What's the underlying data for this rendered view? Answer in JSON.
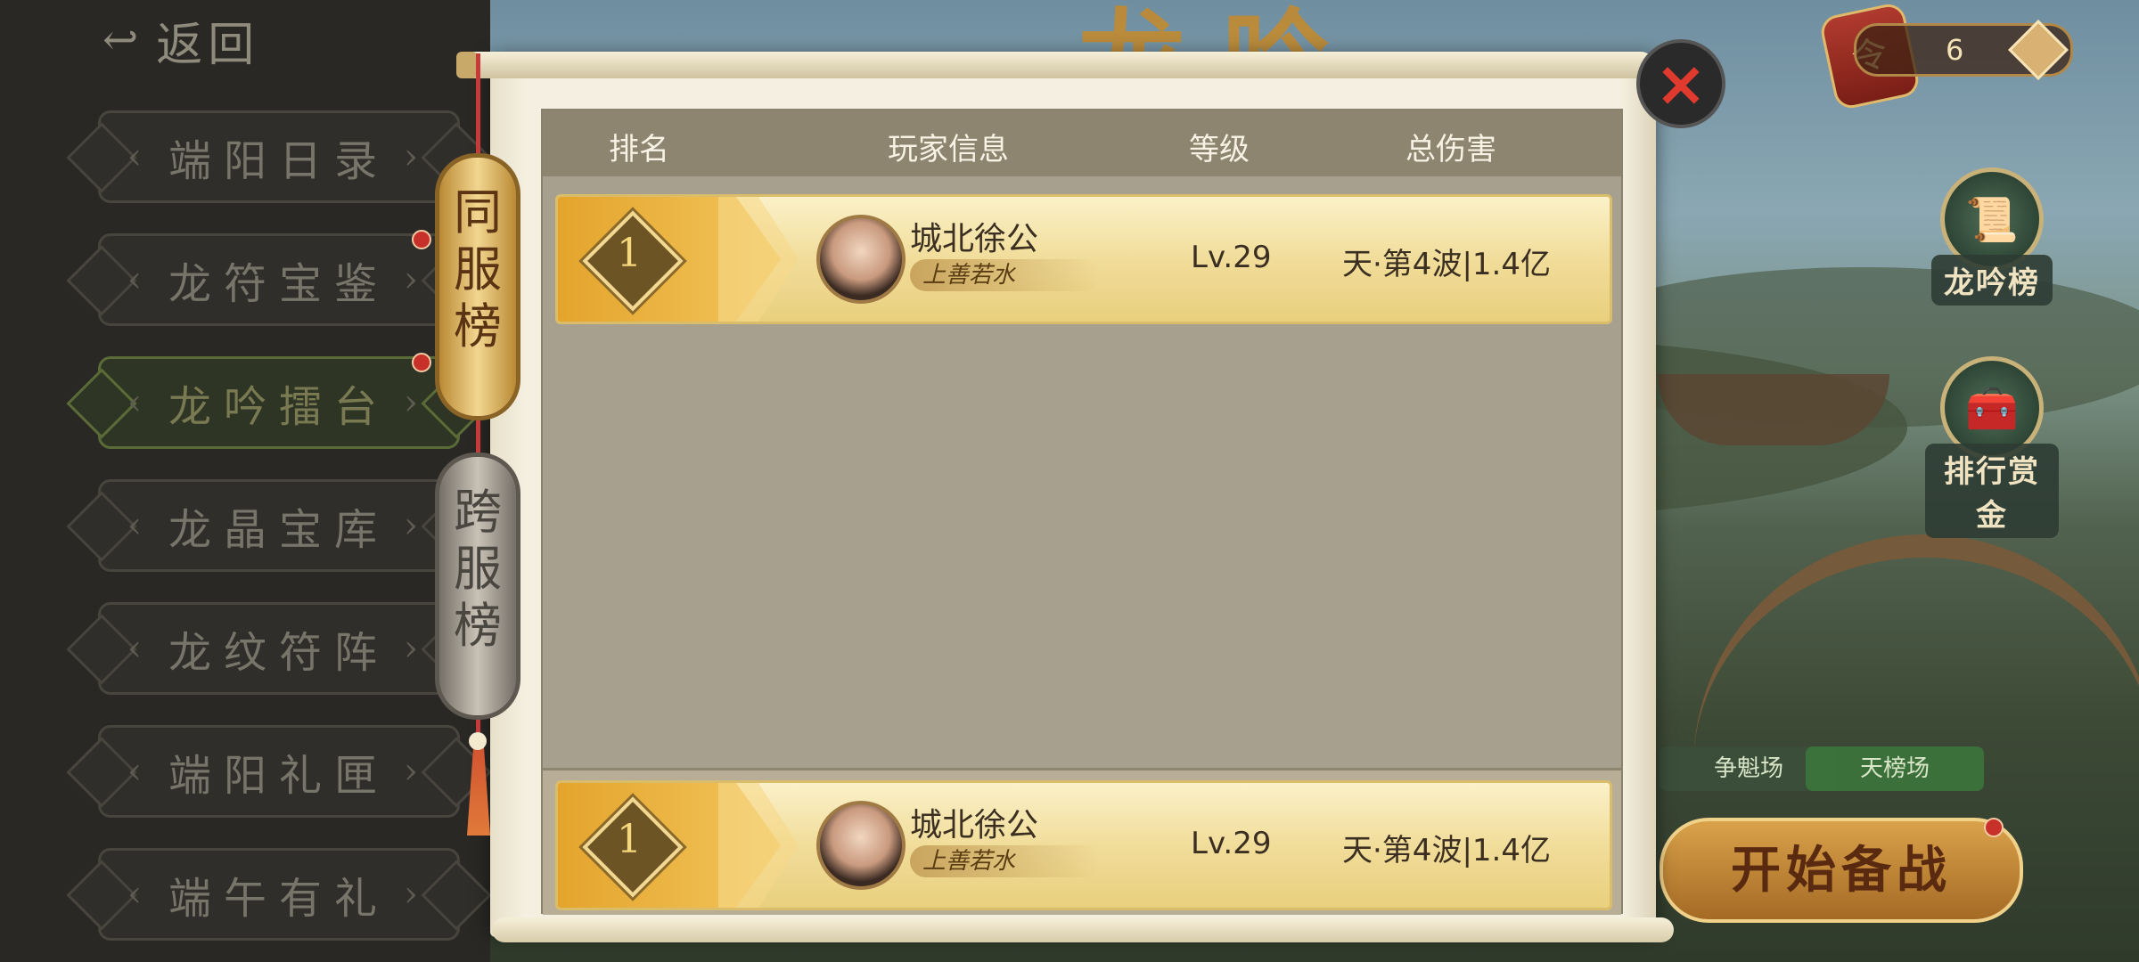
{
  "back_label": "返回",
  "menu": [
    {
      "label": "端阳日录",
      "active": false
    },
    {
      "label": "龙符宝鉴",
      "active": false
    },
    {
      "label": "龙吟擂台",
      "active": true
    },
    {
      "label": "龙晶宝库",
      "active": false
    },
    {
      "label": "龙纹符阵",
      "active": false
    },
    {
      "label": "端阳礼匣",
      "active": false
    },
    {
      "label": "端午有礼",
      "active": false
    }
  ],
  "tabs": {
    "same_server": "同服榜",
    "cross_server": "跨服榜"
  },
  "table": {
    "headers": {
      "rank": "排名",
      "player": "玩家信息",
      "level": "等级",
      "damage": "总伤害"
    },
    "rows": [
      {
        "rank": "1",
        "name": "城北徐公",
        "title": "上善若水",
        "level": "Lv.29",
        "damage": "天·第4波|1.4亿"
      }
    ],
    "self_row": {
      "rank": "1",
      "name": "城北徐公",
      "title": "上善若水",
      "level": "Lv.29",
      "damage": "天·第4波|1.4亿"
    }
  },
  "close_icon": "×",
  "background": {
    "counter_value": "6",
    "side_buttons": {
      "ranking": "龙吟榜",
      "reward": "排行赏金"
    },
    "arena_tabs": [
      "争魁场",
      "天榜场"
    ],
    "start_button": "开始备战"
  },
  "colors": {
    "accent_gold": "#e4a42c",
    "panel": "#a8a08e",
    "header": "#8e8571"
  }
}
